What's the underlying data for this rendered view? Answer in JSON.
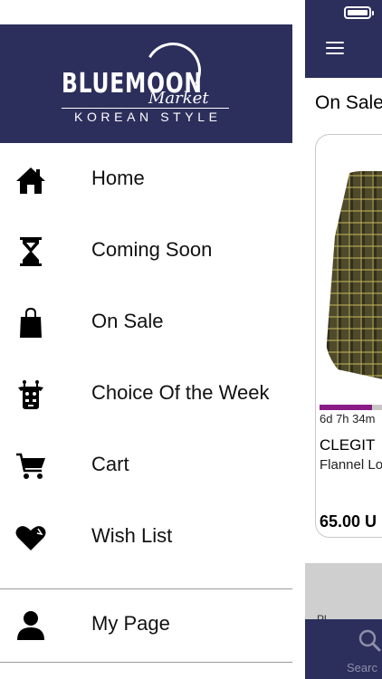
{
  "brand": {
    "title": "BLUEMOON",
    "script": "Market",
    "tagline": "KOREAN STYLE"
  },
  "menu": {
    "items": [
      {
        "label": "Home",
        "icon": "home-icon"
      },
      {
        "label": "Coming Soon",
        "icon": "hourglass-icon"
      },
      {
        "label": "On Sale",
        "icon": "shopping-bag-icon"
      },
      {
        "label": "Choice Of the Week",
        "icon": "giraffe-icon"
      },
      {
        "label": "Cart",
        "icon": "cart-icon"
      },
      {
        "label": "Wish List",
        "icon": "heart-icon"
      }
    ],
    "account": {
      "label": "My Page",
      "icon": "person-icon"
    }
  },
  "background_screen": {
    "section_title": "On Sale",
    "product": {
      "timer": "6d 7h 34m",
      "brand": "CLEGIT",
      "name": "Flannel Lo",
      "price": "65.00 U",
      "progress": 0.55
    },
    "grey_bar_text": "Pl",
    "tab_label": "Searc"
  },
  "colors": {
    "header_bg": "#2c2e5c",
    "progress": "#8a1a86"
  }
}
